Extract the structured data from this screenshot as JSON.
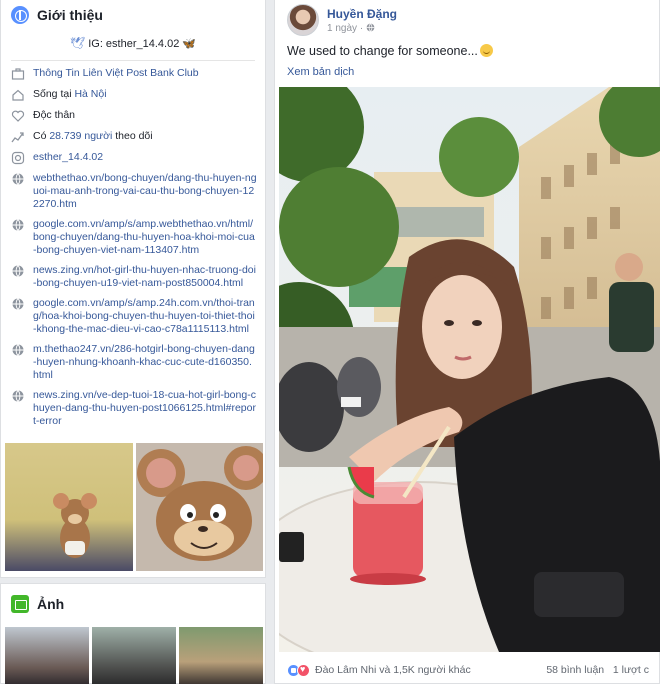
{
  "intro": {
    "title": "Giới thiệu",
    "ig_line": "IG: esther_14.4.02",
    "rows": [
      {
        "icon": "workplace-icon",
        "text": "Thông Tin Liên Việt Post Bank Club"
      },
      {
        "icon": "home-icon",
        "prefix": "Sống tại ",
        "link": "Hà Nội"
      },
      {
        "icon": "heart-icon",
        "text": "Độc thân"
      },
      {
        "icon": "followers-icon",
        "prefix": "Có ",
        "link": "28.739 người",
        "suffix": " theo dõi"
      },
      {
        "icon": "instagram-icon",
        "link": "esther_14.4.02"
      },
      {
        "icon": "globe-icon",
        "link": "webthethao.vn/bong-chuyen/dang-thu-huyen-nguoi-mau-anh-trong-vai-cau-thu-bong-chuyen-122270.htm"
      },
      {
        "icon": "globe-icon",
        "link": "google.com.vn/amp/s/amp.webthethao.vn/html/bong-chuyen/dang-thu-huyen-hoa-khoi-moi-cua-bong-chuyen-viet-nam-113407.htm"
      },
      {
        "icon": "globe-icon",
        "link": "news.zing.vn/hot-girl-thu-huyen-nhac-truong-doi-bong-chuyen-u19-viet-nam-post850004.html"
      },
      {
        "icon": "globe-icon",
        "link": "google.com.vn/amp/s/amp.24h.com.vn/thoi-trang/hoa-khoi-bong-chuyen-thu-huyen-toi-thiet-thoi-khong-the-mac-dieu-vi-cao-c78a1115113.html"
      },
      {
        "icon": "globe-icon",
        "link": "m.thethao247.vn/286-hotgirl-bong-chuyen-dang-huyen-nhung-khoanh-khac-cuc-cute-d160350.html"
      },
      {
        "icon": "globe-icon",
        "link": "news.zing.vn/ve-dep-tuoi-18-cua-hot-girl-bong-chuyen-dang-thu-huyen-post1066125.html#report-error"
      }
    ]
  },
  "photos": {
    "title": "Ảnh"
  },
  "post": {
    "author": "Huyền Đặng",
    "time": "1 ngày",
    "privacy_dot": "·",
    "text": "We used to change for someone...",
    "translate": "Xem bản dịch",
    "reactions_text": "Đào Lâm Nhi và 1,5K người khác",
    "comments": "58 bình luận",
    "shares": "1 lượt c"
  },
  "colors": {
    "link": "#365899",
    "like": "#5890ff",
    "love": "#f25268",
    "photos_icon": "#42b72a"
  }
}
